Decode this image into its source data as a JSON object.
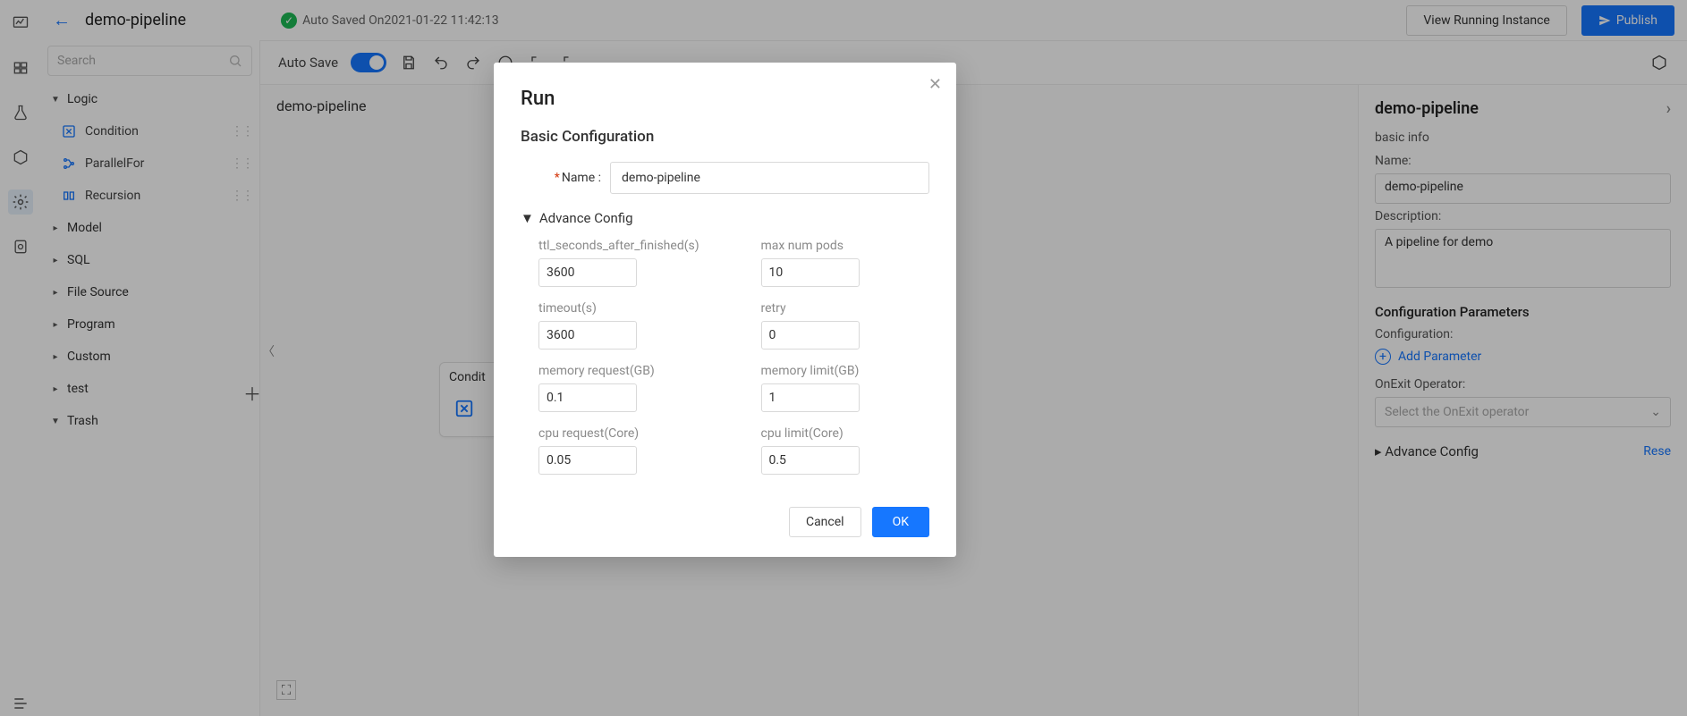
{
  "header": {
    "pipeline_title": "demo-pipeline",
    "auto_saved": "Auto Saved On2021-01-22 11:42:13",
    "view_running": "View  Running  Instance",
    "publish": "Publish"
  },
  "toolbar": {
    "autosave_label": "Auto Save"
  },
  "search": {
    "placeholder": "Search"
  },
  "tree": {
    "groups": [
      {
        "label": "Logic",
        "expanded": true,
        "children": [
          {
            "label": "Condition",
            "icon": "branch-icon"
          },
          {
            "label": "ParallelFor",
            "icon": "parallel-icon"
          },
          {
            "label": "Recursion",
            "icon": "recursion-icon"
          }
        ]
      },
      {
        "label": "Model",
        "expanded": false
      },
      {
        "label": "SQL",
        "expanded": false
      },
      {
        "label": "File Source",
        "expanded": false
      },
      {
        "label": "Program",
        "expanded": false
      },
      {
        "label": "Custom",
        "expanded": false
      },
      {
        "label": "test",
        "expanded": false
      },
      {
        "label": "Trash",
        "expanded": true
      }
    ]
  },
  "canvas": {
    "title": "demo-pipeline",
    "node_label": "Condit"
  },
  "right": {
    "title": "demo-pipeline",
    "basic_info": "basic info",
    "name_label": "Name:",
    "name_value": "demo-pipeline",
    "desc_label": "Description:",
    "desc_value": "A pipeline for demo",
    "config_params": "Configuration Parameters",
    "configuration_label": "Configuration:",
    "add_param": "Add Parameter",
    "onexit_label": "OnExit Operator:",
    "onexit_placeholder": "Select the OnExit operator",
    "advance": "Advance Config",
    "reset": "Rese"
  },
  "modal": {
    "title": "Run",
    "basic": "Basic Configuration",
    "name_label": "Name :",
    "name_value": "demo-pipeline",
    "adv_toggle": "Advance Config",
    "fields": {
      "ttl": {
        "label": "ttl_seconds_after_finished(s)",
        "value": "3600"
      },
      "pods": {
        "label": "max num pods",
        "value": "10"
      },
      "timeout": {
        "label": "timeout(s)",
        "value": "3600"
      },
      "retry": {
        "label": "retry",
        "value": "0"
      },
      "memreq": {
        "label": "memory request(GB)",
        "value": "0.1"
      },
      "memlim": {
        "label": "memory limit(GB)",
        "value": "1"
      },
      "cpureq": {
        "label": "cpu request(Core)",
        "value": "0.05"
      },
      "cpulim": {
        "label": "cpu limit(Core)",
        "value": "0.5"
      }
    },
    "cancel": "Cancel",
    "ok": "OK"
  }
}
